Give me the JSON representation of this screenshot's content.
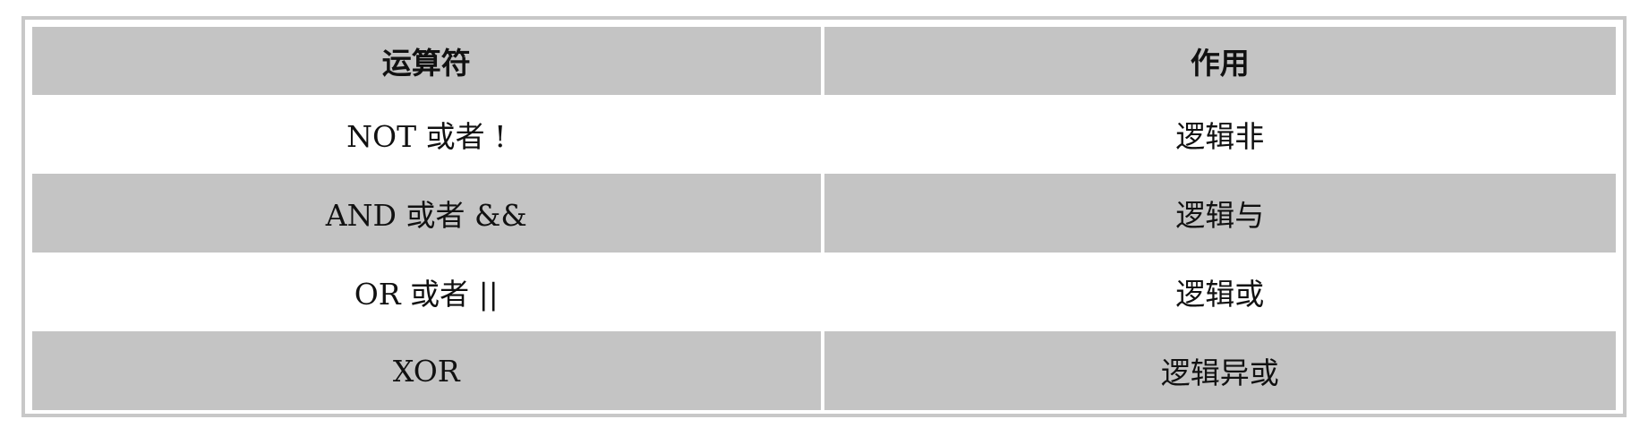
{
  "table": {
    "headers": [
      "运算符",
      "作用"
    ],
    "rows": [
      [
        "NOT 或者 !",
        "逻辑非"
      ],
      [
        "AND 或者 &&",
        "逻辑与"
      ],
      [
        "OR 或者 ||",
        "逻辑或"
      ],
      [
        "XOR",
        "逻辑异或"
      ]
    ]
  }
}
